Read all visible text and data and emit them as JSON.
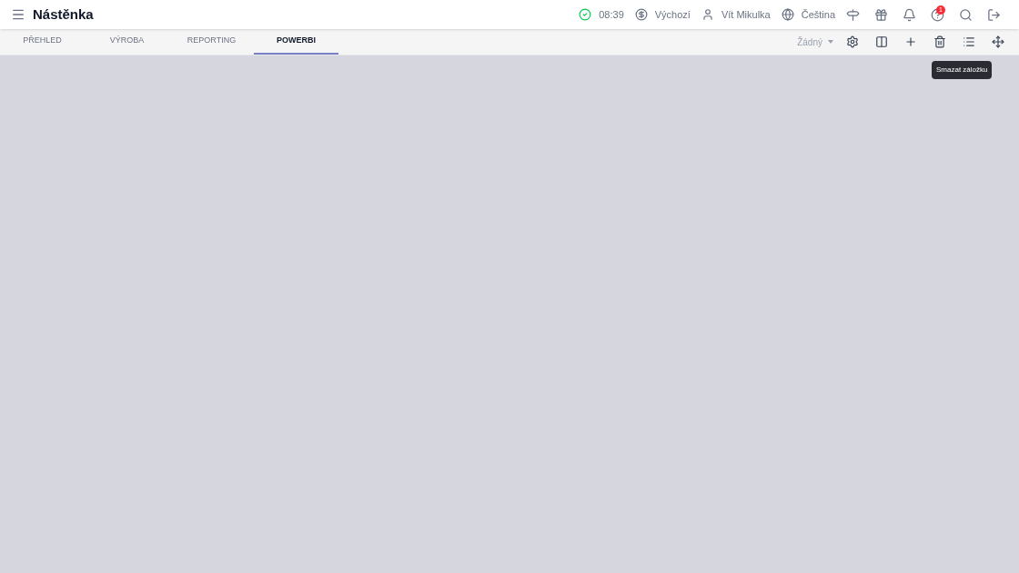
{
  "header": {
    "title": "Nástěnka",
    "time": "08:39",
    "currency": "Výchozí",
    "user": "Vít Mikulka",
    "language": "Čeština",
    "notification_count": "1"
  },
  "tabs": [
    {
      "label": "PŘEHLED",
      "selected": false
    },
    {
      "label": "VÝROBA",
      "selected": false
    },
    {
      "label": "REPORTING",
      "selected": false
    },
    {
      "label": "POWERBI",
      "selected": true
    }
  ],
  "toolbar": {
    "filter": "Žádný",
    "tooltip": "Smazat záložku"
  }
}
